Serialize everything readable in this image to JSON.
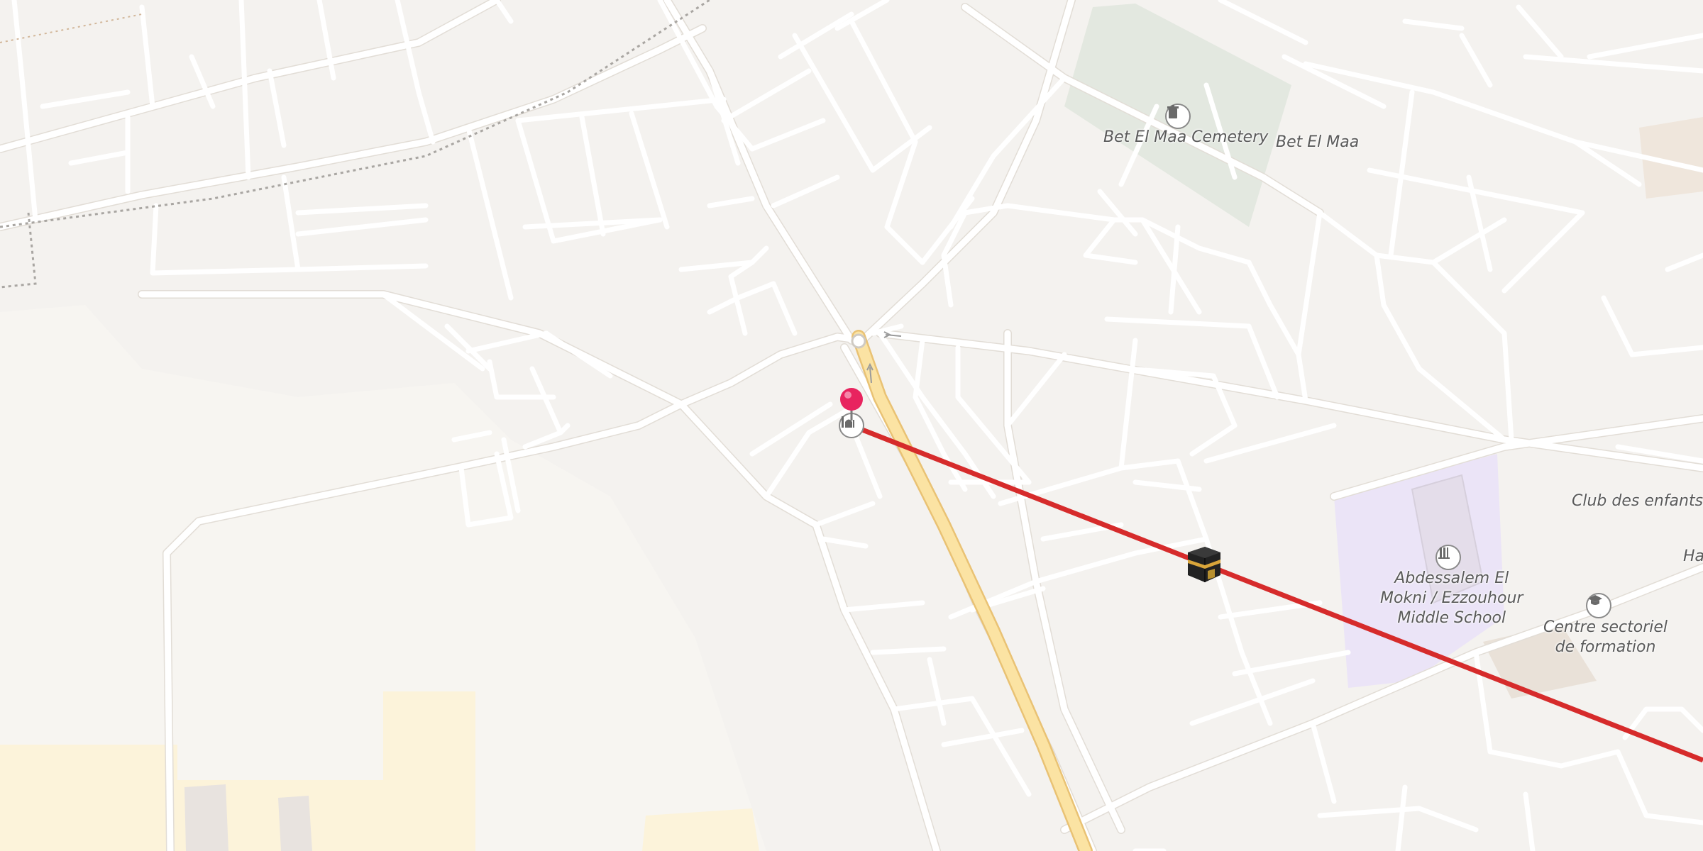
{
  "map": {
    "labels": {
      "cemetery": "Bet El Maa Cemetery",
      "neighborhood": "Bet El Maa",
      "club": "Club des enfants",
      "school_line1": "Abdessalem El",
      "school_line2": "Mokni / Ezzouhour",
      "school_line3": "Middle School",
      "training_line1": "Centre sectoriel",
      "training_line2": "de formation",
      "edge_partial": "Ha"
    },
    "icons": {
      "cemetery": "cemetery-icon",
      "school": "school-icon",
      "training": "graduation-cap-icon",
      "mosque": "mosque-icon",
      "kaaba": "kaaba-icon",
      "pin": "location-pin-icon"
    },
    "colors": {
      "background": "#f4f2ef",
      "road": "#ffffff",
      "major_road": "#fbe3a3",
      "qibla_line": "#d62b2b",
      "pin": "#e8245f",
      "cemetery_area": "#e3e8e0",
      "school_area": "#ece6f8"
    }
  }
}
